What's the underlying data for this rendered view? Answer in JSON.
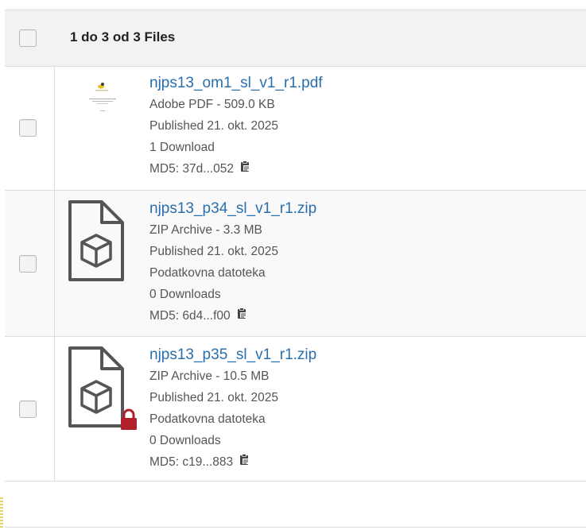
{
  "header": {
    "title": "1 do 3 od 3 Files"
  },
  "files": [
    {
      "name": "njps13_om1_sl_v1_r1.pdf",
      "type_size": "Adobe PDF - 509.0 KB",
      "published": "Published 21. okt. 2025",
      "downloads": "1 Download",
      "md5": "MD5: 37d...052",
      "thumbnail": "pdf-page-preview",
      "locked": false
    },
    {
      "name": "njps13_p34_sl_v1_r1.zip",
      "type_size": "ZIP Archive - 3.3 MB",
      "published": "Published 21. okt. 2025",
      "description": "Podatkovna datoteka",
      "downloads": "0 Downloads",
      "md5": "MD5: 6d4...f00",
      "thumbnail": "zip-archive-icon",
      "locked": false
    },
    {
      "name": "njps13_p35_sl_v1_r1.zip",
      "type_size": "ZIP Archive - 10.5 MB",
      "published": "Published 21. okt. 2025",
      "description": "Podatkovna datoteka",
      "downloads": "0 Downloads",
      "md5": "MD5: c19...883",
      "thumbnail": "zip-archive-icon",
      "locked": true
    }
  ],
  "colors": {
    "link": "#2a6fad",
    "lock": "#b0202a",
    "header_bg": "#f2f2f2"
  }
}
